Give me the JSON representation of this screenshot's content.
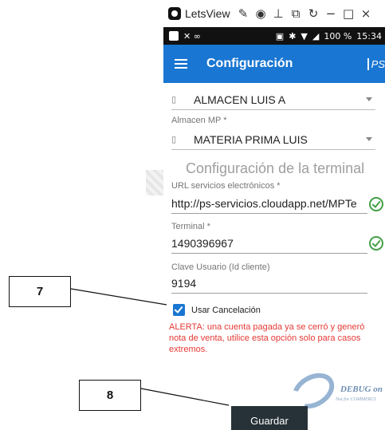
{
  "window": {
    "title": "LetsView",
    "tool_icons": [
      "brush-icon",
      "record-icon",
      "pin-icon",
      "screenshot-icon",
      "rotate-icon"
    ],
    "minimize_glyph": "−",
    "maximize_glyph": "□",
    "close_glyph": "×"
  },
  "status_bar": {
    "left_glyphs": "✕ ∞",
    "battery": "100 %",
    "time": "15:34"
  },
  "app_bar": {
    "title": "Configuración",
    "logo_text": "PS"
  },
  "form": {
    "almacen": {
      "value": "ALMACEN LUIS A"
    },
    "almacen_mp": {
      "label": "Almacen MP *",
      "value": "MATERIA PRIMA LUIS"
    },
    "section_title": "Configuración de la terminal",
    "url": {
      "label": "URL servicios electrónicos *",
      "value": "http://ps-servicios.cloudapp.net/MPTe"
    },
    "terminal": {
      "label": "Terminal *",
      "value": "1490396967"
    },
    "clave": {
      "label": "Clave Usuario (Id cliente)",
      "value": "9194"
    },
    "usar_cancelacion": {
      "label": "Usar Cancelación",
      "checked": true
    },
    "alert": "ALERTA: una cuenta pagada ya se cerró y generó nota de venta, utilice esta opción solo para casos extremos.",
    "save_label": "Guardar"
  },
  "watermark": {
    "text": "DEBUG on",
    "subtext": "Not for COMMERCI"
  },
  "annotations": {
    "callout_7": "7",
    "callout_8": "8"
  },
  "colors": {
    "app_bar": "#1976d2",
    "alert": "#e53935",
    "check": "#43a047",
    "save_button": "#263238"
  }
}
